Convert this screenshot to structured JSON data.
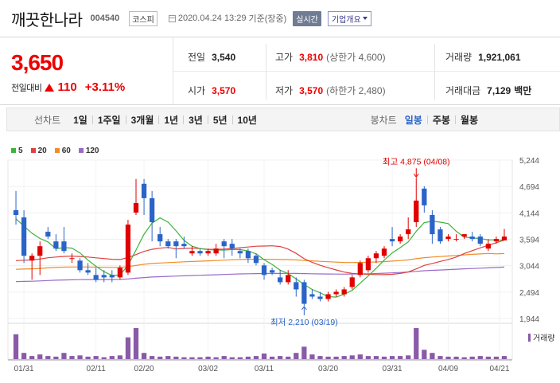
{
  "header": {
    "company_name": "깨끗한나라",
    "code": "004540",
    "market": "코스피",
    "timestamp": "2020.04.24 13:29",
    "timestamp_suffix": "기준(장중)",
    "realtime_label": "실시간",
    "company_info_label": "기업개요"
  },
  "summary": {
    "current_price": "3,650",
    "change_label": "전일대비",
    "change_amount": "110",
    "change_percent": "+3.11%",
    "prev_close_label": "전일",
    "prev_close": "3,540",
    "high_label": "고가",
    "high": "3,810",
    "upper_limit": "(상한가 4,600)",
    "volume_label": "거래량",
    "volume": "1,921,061",
    "open_label": "시가",
    "open": "3,570",
    "low_label": "저가",
    "low": "3,570",
    "lower_limit": "(하한가 2,480)",
    "amount_label": "거래대금",
    "amount": "7,129",
    "amount_unit": "백만"
  },
  "period_bar": {
    "chart_label": "선차트",
    "periods": [
      "1일",
      "1주일",
      "3개월",
      "1년",
      "3년",
      "5년",
      "10년"
    ],
    "candle_label": "봉차트",
    "candle_periods": [
      "일봉",
      "주봉",
      "월봉"
    ],
    "active_candle": "일봉"
  },
  "colors": {
    "up": "#e00000",
    "down": "#2a64c8",
    "ma5": "#3cb43c",
    "ma20": "#e04040",
    "ma60": "#f08c28",
    "ma120": "#9a6ac8",
    "volume": "#8a5aa8"
  },
  "chart_data": {
    "type": "candlestick",
    "legend": [
      "5",
      "20",
      "60",
      "120"
    ],
    "y_ticks": [
      "5,244",
      "4,694",
      "4,144",
      "3,594",
      "3,044",
      "2,494",
      "1,944"
    ],
    "y_range": [
      1944,
      5244
    ],
    "x_ticks": [
      "01/31",
      "02/11",
      "02/20",
      "03/02",
      "03/11",
      "03/20",
      "03/31",
      "04/09",
      "04/21"
    ],
    "max_annotation": "최고 4,875 (04/08)",
    "min_annotation": "최저 2,210 (03/19)",
    "volume_label": "거래량",
    "candles": [
      {
        "o": 4200,
        "c": 4100,
        "h": 4600,
        "l": 3900
      },
      {
        "o": 4050,
        "c": 3250,
        "h": 4200,
        "l": 3100
      },
      {
        "o": 3150,
        "c": 3250,
        "h": 3300,
        "l": 2750
      },
      {
        "o": 3250,
        "c": 3450,
        "h": 3550,
        "l": 2850
      },
      {
        "o": 3750,
        "c": 3650,
        "h": 3850,
        "l": 3600
      },
      {
        "o": 3550,
        "c": 3400,
        "h": 3700,
        "l": 3350
      },
      {
        "o": 3550,
        "c": 3350,
        "h": 3850,
        "l": 3300
      },
      {
        "o": 3200,
        "c": 3200,
        "h": 3300,
        "l": 3100
      },
      {
        "o": 3150,
        "c": 2950,
        "h": 3200,
        "l": 2900
      },
      {
        "o": 2950,
        "c": 2900,
        "h": 3100,
        "l": 2850
      },
      {
        "o": 2850,
        "c": 2750,
        "h": 3000,
        "l": 2700
      },
      {
        "o": 2850,
        "c": 2800,
        "h": 2950,
        "l": 2700
      },
      {
        "o": 2850,
        "c": 2800,
        "h": 2950,
        "l": 2700
      },
      {
        "o": 2800,
        "c": 3000,
        "h": 3050,
        "l": 2750
      },
      {
        "o": 2900,
        "c": 3900,
        "h": 4000,
        "l": 2850
      },
      {
        "o": 4150,
        "c": 4350,
        "h": 4850,
        "l": 4100
      },
      {
        "o": 4750,
        "c": 4450,
        "h": 4850,
        "l": 4100
      },
      {
        "o": 4450,
        "c": 3950,
        "h": 4600,
        "l": 3550
      },
      {
        "o": 3700,
        "c": 3550,
        "h": 3850,
        "l": 3450
      },
      {
        "o": 3550,
        "c": 3450,
        "h": 3600,
        "l": 3400
      },
      {
        "o": 3550,
        "c": 3450,
        "h": 3600,
        "l": 3200
      },
      {
        "o": 3500,
        "c": 3450,
        "h": 3650,
        "l": 3400
      },
      {
        "o": 3300,
        "c": 3350,
        "h": 3450,
        "l": 3250
      },
      {
        "o": 3350,
        "c": 3300,
        "h": 3400,
        "l": 3250
      },
      {
        "o": 3300,
        "c": 3350,
        "h": 3400,
        "l": 3250
      },
      {
        "o": 3300,
        "c": 3400,
        "h": 3500,
        "l": 3250
      },
      {
        "o": 3550,
        "c": 3450,
        "h": 3600,
        "l": 3200
      },
      {
        "o": 3500,
        "c": 3400,
        "h": 3600,
        "l": 3250
      },
      {
        "o": 3350,
        "c": 3300,
        "h": 3400,
        "l": 3200
      },
      {
        "o": 3350,
        "c": 3200,
        "h": 3400,
        "l": 3100
      },
      {
        "o": 3250,
        "c": 3100,
        "h": 3300,
        "l": 3050
      },
      {
        "o": 3050,
        "c": 2850,
        "h": 3100,
        "l": 2750
      },
      {
        "o": 2950,
        "c": 2900,
        "h": 3000,
        "l": 2850
      },
      {
        "o": 2800,
        "c": 2700,
        "h": 2950,
        "l": 2650
      },
      {
        "o": 2700,
        "c": 2850,
        "h": 2950,
        "l": 2650
      },
      {
        "o": 2700,
        "c": 2550,
        "h": 2800,
        "l": 2400
      },
      {
        "o": 2700,
        "c": 2250,
        "h": 2750,
        "l": 2210
      },
      {
        "o": 2450,
        "c": 2400,
        "h": 2550,
        "l": 2350
      },
      {
        "o": 2400,
        "c": 2350,
        "h": 2500,
        "l": 2300
      },
      {
        "o": 2350,
        "c": 2450,
        "h": 2500,
        "l": 2300
      },
      {
        "o": 2450,
        "c": 2500,
        "h": 2550,
        "l": 2400
      },
      {
        "o": 2450,
        "c": 2550,
        "h": 2600,
        "l": 2400
      },
      {
        "o": 2600,
        "c": 2800,
        "h": 2850,
        "l": 2550
      },
      {
        "o": 2850,
        "c": 3100,
        "h": 3150,
        "l": 2800
      },
      {
        "o": 2950,
        "c": 3200,
        "h": 3250,
        "l": 2900
      },
      {
        "o": 3200,
        "c": 3300,
        "h": 3350,
        "l": 3100
      },
      {
        "o": 3250,
        "c": 3400,
        "h": 3450,
        "l": 3200
      },
      {
        "o": 3600,
        "c": 3550,
        "h": 3850,
        "l": 3450
      },
      {
        "o": 3550,
        "c": 3650,
        "h": 3700,
        "l": 3500
      },
      {
        "o": 3700,
        "c": 3800,
        "h": 4050,
        "l": 3600
      },
      {
        "o": 3950,
        "c": 4400,
        "h": 4875,
        "l": 3850
      },
      {
        "o": 4650,
        "c": 4300,
        "h": 4700,
        "l": 4150
      },
      {
        "o": 4100,
        "c": 3700,
        "h": 4200,
        "l": 3500
      },
      {
        "o": 3800,
        "c": 3550,
        "h": 3850,
        "l": 3500
      },
      {
        "o": 3600,
        "c": 3650,
        "h": 3700,
        "l": 3550
      },
      {
        "o": 3600,
        "c": 3600,
        "h": 3700,
        "l": 3550
      },
      {
        "o": 3650,
        "c": 3700,
        "h": 3700,
        "l": 3600
      },
      {
        "o": 3650,
        "c": 3600,
        "h": 3750,
        "l": 3550
      },
      {
        "o": 3650,
        "c": 3500,
        "h": 3700,
        "l": 3450
      },
      {
        "o": 3400,
        "c": 3500,
        "h": 3600,
        "l": 3350
      },
      {
        "o": 3550,
        "c": 3600,
        "h": 3650,
        "l": 3500
      },
      {
        "o": 3570,
        "c": 3650,
        "h": 3810,
        "l": 3570
      }
    ],
    "volume": [
      80,
      20,
      10,
      15,
      10,
      8,
      20,
      10,
      12,
      8,
      10,
      6,
      10,
      12,
      70,
      100,
      20,
      10,
      8,
      10,
      8,
      6,
      6,
      6,
      8,
      6,
      10,
      6,
      6,
      8,
      10,
      18,
      8,
      10,
      8,
      20,
      40,
      15,
      10,
      8,
      8,
      10,
      12,
      15,
      10,
      10,
      8,
      10,
      10,
      12,
      100,
      30,
      20,
      10,
      8,
      8,
      6,
      8,
      10,
      8,
      8,
      10
    ]
  }
}
